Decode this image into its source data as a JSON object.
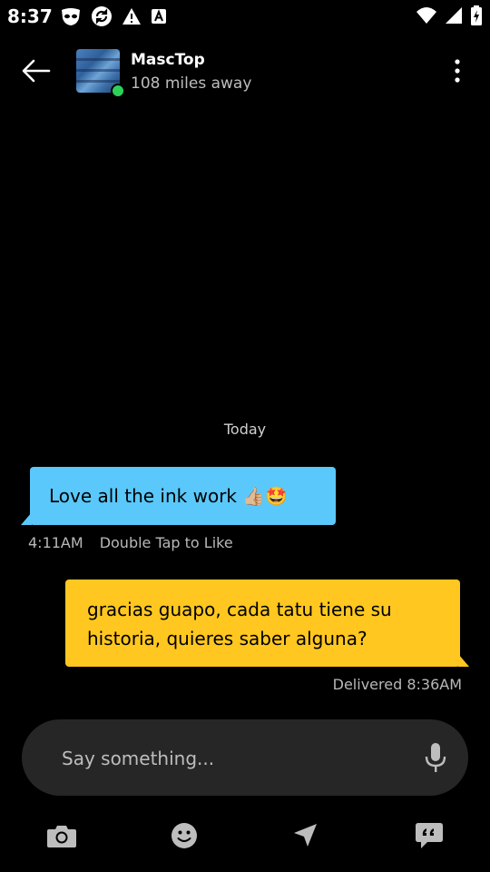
{
  "status_bar": {
    "time": "8:37",
    "left_icons": [
      "grindr-mask-icon",
      "sync-icon",
      "warning-icon",
      "font-a-icon"
    ],
    "right_icons": [
      "wifi-icon",
      "signal-icon",
      "battery-charging-icon"
    ]
  },
  "header": {
    "name": "MascTop",
    "distance": "108 miles away",
    "online_color": "#2ed158"
  },
  "conversation": {
    "date_label": "Today",
    "incoming": {
      "text": "Love all the ink work 👍🏼🤩",
      "time": "4:11AM",
      "hint": "Double Tap to Like",
      "color": "#5ac8fa"
    },
    "outgoing": {
      "text": "gracias guapo, cada tatu tiene su historia, quieres saber alguna?",
      "status": "Delivered 8:36AM",
      "color": "#ffc71f"
    }
  },
  "composer": {
    "placeholder": "Say something..."
  },
  "toolbar": [
    "camera-icon",
    "emoji-icon",
    "send-location-icon",
    "saved-phrases-icon"
  ]
}
